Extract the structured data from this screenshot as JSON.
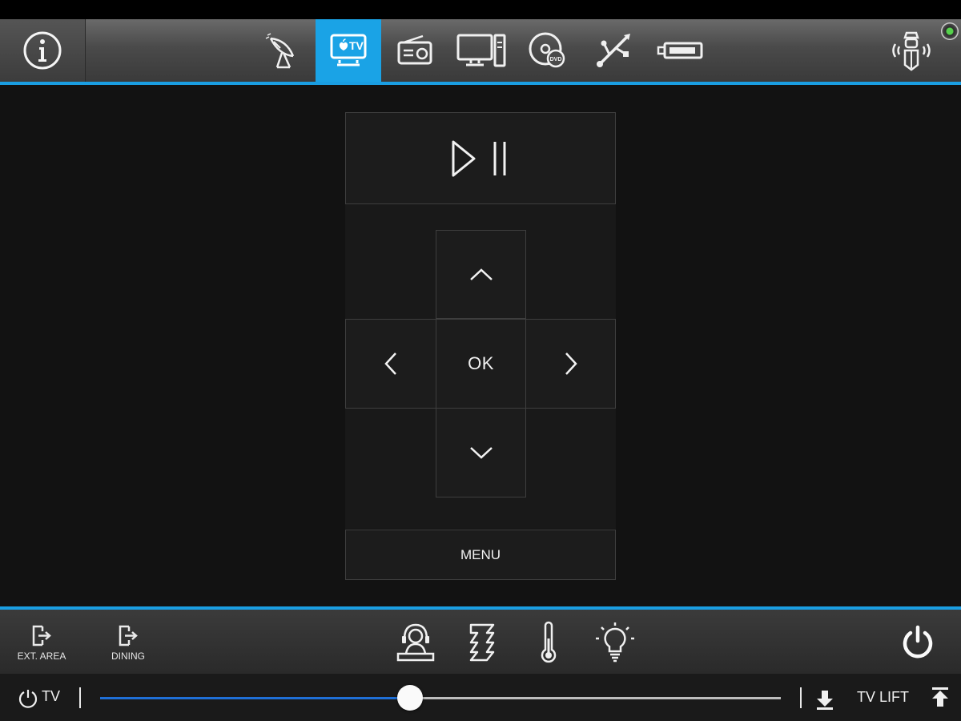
{
  "header": {
    "info_button": "info",
    "sources": [
      {
        "id": "satellite",
        "icon": "satellite-dish-icon",
        "active": false
      },
      {
        "id": "apple-tv",
        "icon": "apple-tv-icon",
        "label": "TV",
        "active": true
      },
      {
        "id": "radio",
        "icon": "radio-icon",
        "active": false
      },
      {
        "id": "computer",
        "icon": "computer-icon",
        "active": false
      },
      {
        "id": "dvd",
        "icon": "dvd-icon",
        "label": "DVD",
        "active": false
      },
      {
        "id": "usb",
        "icon": "usb-icon",
        "active": false
      },
      {
        "id": "hdmi",
        "icon": "hdmi-icon",
        "active": false
      }
    ],
    "remote_icon": "wireless-remote-icon",
    "status_color": "#56d24c"
  },
  "remote": {
    "play_pause_icon": "play-pause-icon",
    "ok_label": "OK",
    "menu_label": "MENU"
  },
  "footer": {
    "areas": [
      {
        "label": "EXT. AREA",
        "icon": "exit-door-icon"
      },
      {
        "label": "DINING",
        "icon": "exit-door-icon"
      }
    ],
    "controls": [
      "concierge-icon",
      "blinds-icon",
      "thermometer-icon",
      "light-bulb-icon"
    ],
    "power_icon": "power-icon"
  },
  "slider_bar": {
    "tv_label": "TV",
    "volume_fraction": 0.455,
    "lift_label": "TV LIFT"
  },
  "colors": {
    "accent": "#1aa3e6",
    "slider_fill": "#1f6fd6",
    "background": "#121212"
  }
}
